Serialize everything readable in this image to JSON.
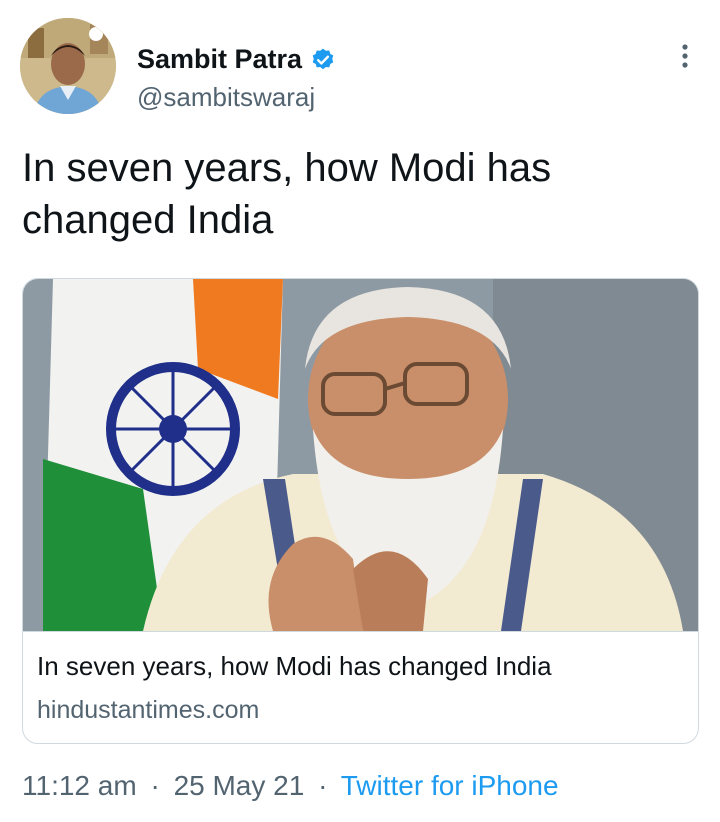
{
  "author": {
    "display_name": "Sambit Patra",
    "handle": "@sambitswaraj",
    "verified_icon": "verified-badge-icon"
  },
  "tweet": {
    "text": "In seven years, how Modi has changed India"
  },
  "link_card": {
    "title": "In seven years, how Modi has changed India",
    "domain": "hindustantimes.com"
  },
  "meta": {
    "time": "11:12 am",
    "separator": "·",
    "date": "25 May 21",
    "source": "Twitter for iPhone"
  },
  "colors": {
    "text": "#0f1419",
    "secondary": "#536471",
    "accent": "#1d9bf0",
    "border": "#cfd9de"
  }
}
